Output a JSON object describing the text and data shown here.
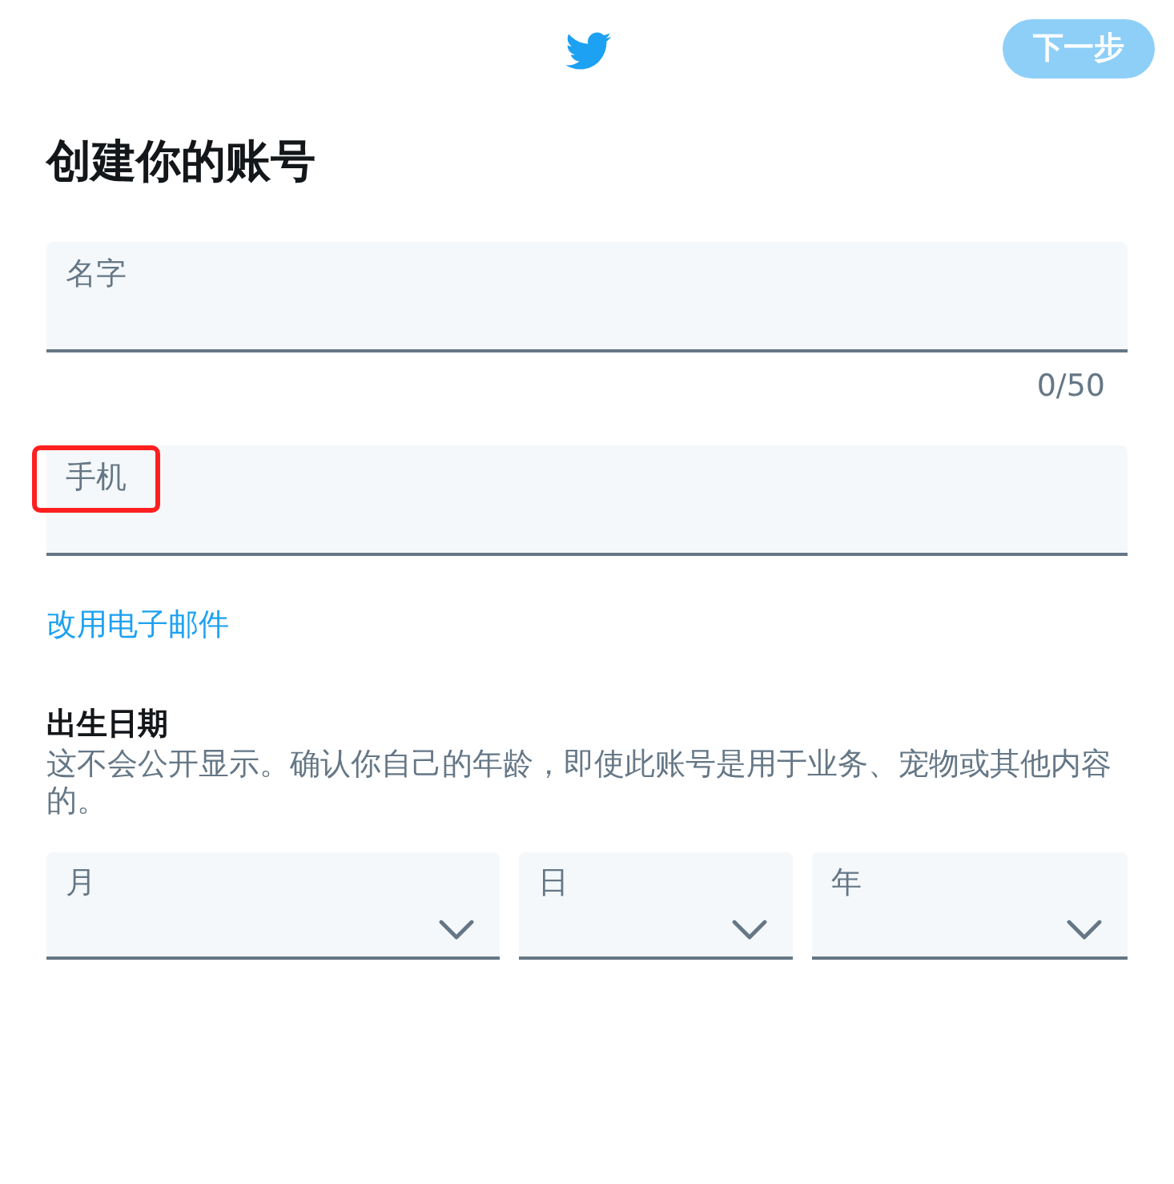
{
  "header": {
    "next_button": {
      "label": "下一步",
      "disabled": true
    }
  },
  "title": "创建你的账号",
  "name_field": {
    "placeholder": "名字",
    "counter": "0/50"
  },
  "phone_field": {
    "placeholder": "手机",
    "highlighted": true
  },
  "switch_link": "改用电子邮件",
  "birth_date": {
    "heading": "出生日期",
    "description": "这不会公开显示。确认你自己的年龄，即使此账号是用于业务、宠物或其他内容的。",
    "selects": [
      {
        "label": "月"
      },
      {
        "label": "日"
      },
      {
        "label": "年"
      }
    ]
  }
}
